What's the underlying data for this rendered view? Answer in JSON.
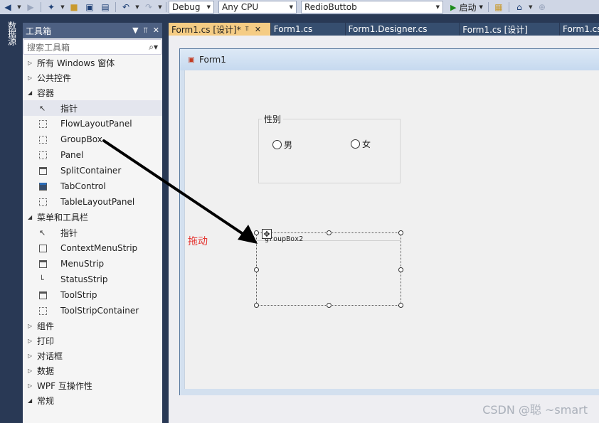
{
  "toolbar": {
    "configuration": "Debug",
    "platform": "Any CPU",
    "project": "RedioButtob",
    "start_label": "启动"
  },
  "side_tab": {
    "label": "数据源"
  },
  "toolbox": {
    "title": "工具箱",
    "search_placeholder": "搜索工具箱",
    "categories": [
      {
        "label": "所有 Windows 窗体",
        "expanded": false
      },
      {
        "label": "公共控件",
        "expanded": false
      },
      {
        "label": "容器",
        "expanded": true,
        "items": [
          "指针",
          "FlowLayoutPanel",
          "GroupBox",
          "Panel",
          "SplitContainer",
          "TabControl",
          "TableLayoutPanel"
        ]
      },
      {
        "label": "菜单和工具栏",
        "expanded": true,
        "items": [
          "指针",
          "ContextMenuStrip",
          "MenuStrip",
          "StatusStrip",
          "ToolStrip",
          "ToolStripContainer"
        ]
      },
      {
        "label": "组件",
        "expanded": false
      },
      {
        "label": "打印",
        "expanded": false
      },
      {
        "label": "对话框",
        "expanded": false
      },
      {
        "label": "数据",
        "expanded": false
      },
      {
        "label": "WPF 互操作性",
        "expanded": false
      },
      {
        "label": "常规",
        "expanded": true
      }
    ]
  },
  "tabs": [
    {
      "label": "Form1.cs [设计]*",
      "active": true
    },
    {
      "label": "Form1.cs",
      "active": false
    },
    {
      "label": "Form1.Designer.cs",
      "active": false
    },
    {
      "label": "Form1.cs [设计]",
      "active": false
    },
    {
      "label": "Form1.cs",
      "active": false
    }
  ],
  "form": {
    "title": "Form1",
    "groupbox1": {
      "title": "性别",
      "radio_male": "男",
      "radio_female": "女"
    },
    "groupbox2": {
      "title": "groupBox2"
    },
    "drag_annotation": "拖动"
  },
  "watermark": "CSDN @聪    ~smart",
  "colors": {
    "ide_background": "#293955",
    "active_tab": "#f5cc84",
    "annotation_red": "#e53935"
  }
}
